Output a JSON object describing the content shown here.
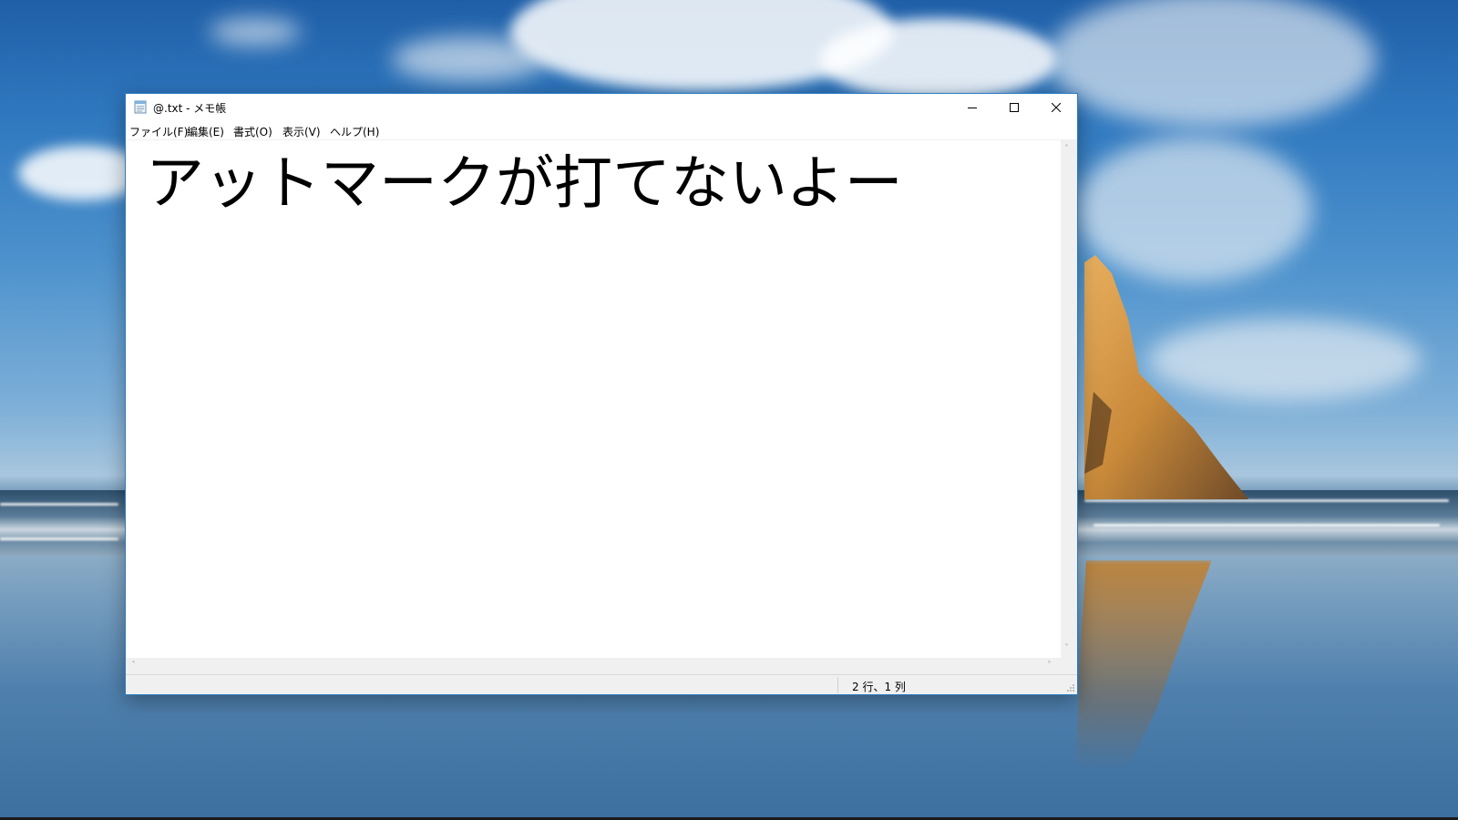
{
  "window": {
    "title": "@.txt - メモ帳",
    "border_color": "#2b79c2"
  },
  "menu": {
    "items": [
      "ファイル(F)",
      "編集(E)",
      "書式(O)",
      "表示(V)",
      "ヘルプ(H)"
    ]
  },
  "editor": {
    "text": "アットマークが打てないよー"
  },
  "status": {
    "position": "2 行、1 列"
  },
  "icons": {
    "app": "notepad-icon",
    "minimize": "minimize-icon",
    "maximize": "maximize-icon",
    "close": "close-icon"
  }
}
